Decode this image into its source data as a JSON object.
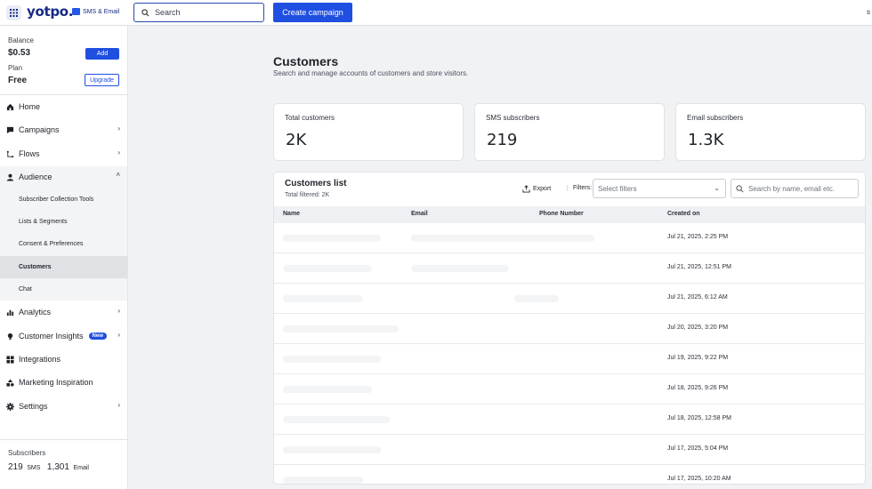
{
  "topbar": {
    "brand": "yotpo.",
    "product": "SMS & Email",
    "search_label": "Search",
    "create_label": "Create campaign",
    "user_initial": "s"
  },
  "sidebar": {
    "balance_label": "Balance",
    "balance_value": "$0.53",
    "add_label": "Add",
    "plan_label": "Plan",
    "plan_value": "Free",
    "upgrade_label": "Upgrade",
    "items": [
      {
        "label": "Home",
        "icon": "home-icon"
      },
      {
        "label": "Campaigns",
        "icon": "campaign-icon"
      },
      {
        "label": "Flows",
        "icon": "flow-icon"
      },
      {
        "label": "Audience",
        "icon": "person-icon"
      },
      {
        "label": "Analytics",
        "icon": "bar-chart-icon"
      },
      {
        "label": "Customer Insights",
        "icon": "lightbulb-icon",
        "badge": "New"
      },
      {
        "label": "Integrations",
        "icon": "grid-icon"
      },
      {
        "label": "Marketing Inspiration",
        "icon": "shapes-icon"
      },
      {
        "label": "Settings",
        "icon": "gear-icon"
      }
    ],
    "audience_sub": [
      "Subscriber Collection Tools",
      "Lists & Segments",
      "Consent & Preferences",
      "Customers",
      "Chat"
    ],
    "subscribers_label": "Subscribers",
    "sms_count": "219",
    "sms_label": "SMS",
    "email_count": "1,301",
    "email_label": "Email"
  },
  "main": {
    "title": "Customers",
    "subtitle": "Search and manage accounts of customers and store visitors.",
    "stats": [
      {
        "label": "Total customers",
        "value": "2K"
      },
      {
        "label": "SMS subscribers",
        "value": "219"
      },
      {
        "label": "Email subscribers",
        "value": "1.3K"
      }
    ],
    "list": {
      "title": "Customers list",
      "filtered": "Total filtered: 2K",
      "export_label": "Export",
      "filters_label": "Filters:",
      "filters_placeholder": "Select filters",
      "search_placeholder": "Search by name, email etc.",
      "columns": [
        "Name",
        "Email",
        "Phone Number",
        "Created on"
      ],
      "rows": [
        {
          "created": "Jul 21, 2025, 2:25 PM"
        },
        {
          "created": "Jul 21, 2025, 12:51 PM"
        },
        {
          "created": "Jul 21, 2025, 6:12 AM"
        },
        {
          "created": "Jul 20, 2025, 3:20 PM"
        },
        {
          "created": "Jul 19, 2025, 9:22 PM"
        },
        {
          "created": "Jul 18, 2025, 9:26 PM"
        },
        {
          "created": "Jul 18, 2025, 12:58 PM"
        },
        {
          "created": "Jul 17, 2025, 5:04 PM"
        },
        {
          "created": "Jul 17, 2025, 10:20 AM"
        }
      ]
    }
  }
}
